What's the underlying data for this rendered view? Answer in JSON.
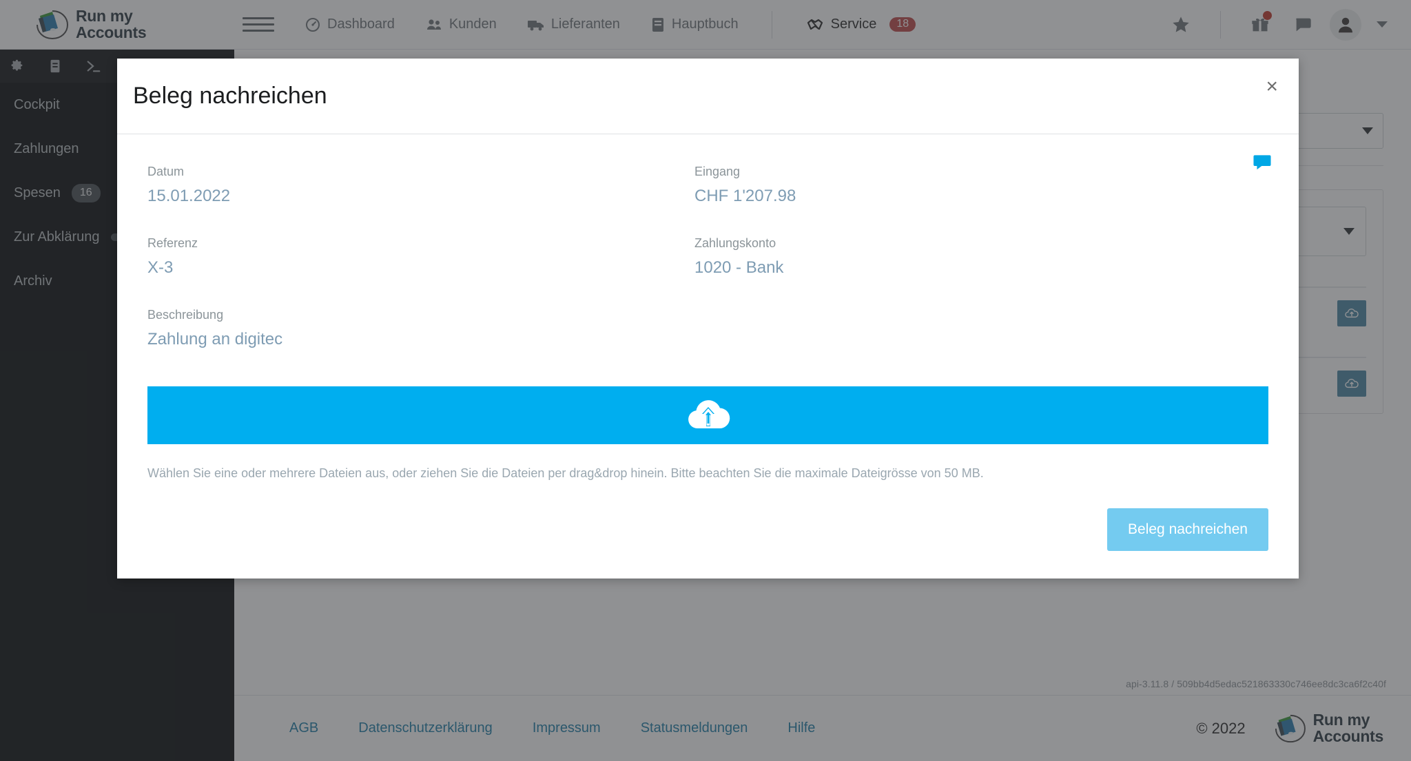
{
  "navbar": {
    "brand": {
      "line1": "Run my",
      "line2": "Accounts"
    },
    "menu_icon": "hamburger-menu-icon",
    "links": [
      {
        "label": "Dashboard",
        "icon": "gauge-icon"
      },
      {
        "label": "Kunden",
        "icon": "users-icon"
      },
      {
        "label": "Lieferanten",
        "icon": "truck-icon"
      },
      {
        "label": "Hauptbuch",
        "icon": "book-icon"
      }
    ],
    "service": {
      "label": "Service",
      "icon": "handshake-icon",
      "badge": "18"
    },
    "right_icons": [
      {
        "name": "star-icon"
      },
      {
        "name": "gift-icon",
        "has_dot": true
      },
      {
        "name": "chat-bubble-icon"
      },
      {
        "name": "user-avatar-icon"
      }
    ]
  },
  "sidebar": {
    "tools": [
      {
        "name": "gear-icon"
      },
      {
        "name": "document-icon"
      },
      {
        "name": "terminal-icon"
      }
    ],
    "items": [
      {
        "label": "Cockpit",
        "badge": ""
      },
      {
        "label": "Zahlungen",
        "badge": ""
      },
      {
        "label": "Spesen",
        "badge": "16"
      },
      {
        "label": "Zur Abklärung",
        "badge": ""
      },
      {
        "label": "Archiv",
        "badge": ""
      }
    ]
  },
  "background": {
    "version": "api-3.11.8 / 509bb4d5edac521863330c746ee8dc3ca6f2c40f"
  },
  "modal": {
    "title": "Beleg nachreichen",
    "close_label": "×",
    "comment_icon": "comment-bubble-icon",
    "fields": {
      "datum": {
        "label": "Datum",
        "value": "15.01.2022"
      },
      "referenz": {
        "label": "Referenz",
        "value": "X-3"
      },
      "beschreibung": {
        "label": "Beschreibung",
        "value": "Zahlung an digitec"
      },
      "eingang": {
        "label": "Eingang",
        "value": "CHF 1'207.98"
      },
      "zahlungskonto": {
        "label": "Zahlungskonto",
        "value": "1020 - Bank"
      }
    },
    "dropzone": {
      "icon": "cloud-upload-icon"
    },
    "hint": "Wählen Sie eine oder mehrere Dateien aus, oder ziehen Sie die Dateien per drag&drop hinein. Bitte beachten Sie die maximale Dateigrösse von 50 MB.",
    "submit_label": "Beleg nachreichen"
  },
  "footer": {
    "links": [
      {
        "label": "AGB"
      },
      {
        "label": "Datenschutzerklärung"
      },
      {
        "label": "Impressum"
      },
      {
        "label": "Statusmeldungen"
      },
      {
        "label": "Hilfe"
      }
    ],
    "copyright": "© 2022",
    "brand": {
      "line1": "Run my",
      "line2": "Accounts"
    }
  },
  "colors": {
    "accent_blue": "#00aeef",
    "button_blue": "#74cbf0",
    "sidebar_bg": "#0d0f10",
    "badge_red": "#bf4a4a",
    "value_blue": "#7e9cb3",
    "link_blue": "#1f7fa8"
  }
}
